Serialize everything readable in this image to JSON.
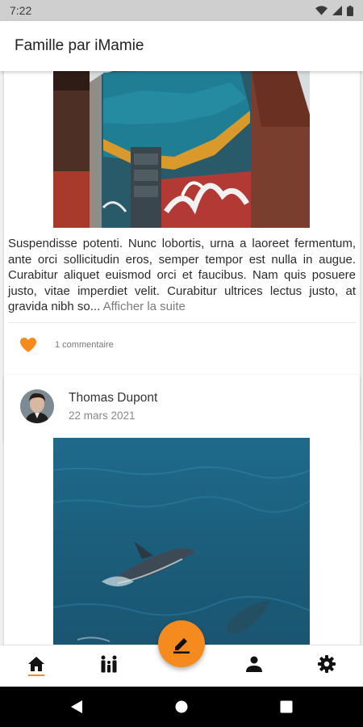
{
  "status_bar": {
    "time": "7:22"
  },
  "app_bar": {
    "title": "Famille par iMamie"
  },
  "colors": {
    "accent": "#f58a1f"
  },
  "posts": [
    {
      "text": "Suspendisse potenti. Nunc lobortis, urna a laoreet fermentum, ante orci sollicitudin eros, semper tempor est nulla in augue. Curabitur aliquet euismod orci et faucibus. Nam quis posuere justo, vitae imperdiet velit. Curabitur ultrices lectus justo, at gravida nibh so...",
      "show_more": "Afficher la suite",
      "comments": "1 commentaire",
      "liked": true
    },
    {
      "author": "Thomas Dupont",
      "date": "22 mars 2021"
    }
  ],
  "bottom_nav": {
    "items": [
      "home-icon",
      "family-icon",
      "edit-icon",
      "person-icon",
      "gear-icon"
    ],
    "active": "home-icon"
  }
}
